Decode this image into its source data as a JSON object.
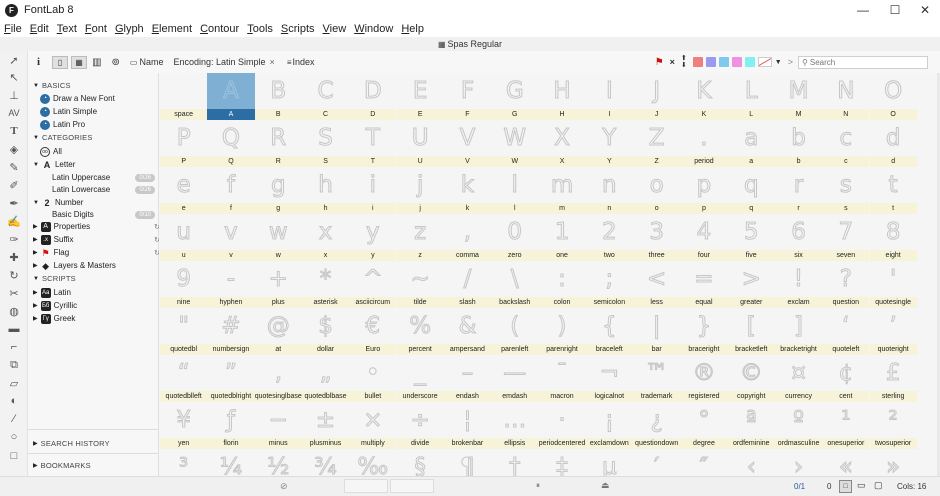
{
  "app": {
    "title": "FontLab 8"
  },
  "window_controls": {
    "minimize": "—",
    "maximize": "☐",
    "close": "✕"
  },
  "menu": [
    "File",
    "Edit",
    "Text",
    "Font",
    "Glyph",
    "Element",
    "Contour",
    "Tools",
    "Scripts",
    "View",
    "Window",
    "Help"
  ],
  "doc": {
    "name": "Spas Regular"
  },
  "toolbar": {
    "info_label": "i",
    "name_label": "Name",
    "encoding_label": "Encoding: Latin Simple",
    "close_x": "×",
    "index_label": "Index",
    "flag_close": "×",
    "more_label": ">",
    "search_placeholder": "Search",
    "swatch_colors": [
      "#f08080",
      "#9a9af0",
      "#7fc8f0",
      "#f090e0",
      "#80f0f0"
    ]
  },
  "sidebar": {
    "basics_header": "BASICS",
    "basics": [
      "Draw a New Font",
      "Latin Simple",
      "Latin Pro"
    ],
    "categories_header": "CATEGORIES",
    "all_label": "All",
    "letter_label": "Letter",
    "latin_uppercase": "Latin Uppercase",
    "latin_uppercase_count": "0/26",
    "latin_lowercase": "Latin Lowercase",
    "latin_lowercase_count": "0/26",
    "number_label": "Number",
    "basic_digits": "Basic Digits",
    "basic_digits_count": "0/10",
    "properties_label": "Properties",
    "suffix_label": "Suffix",
    "flag_label": "Flag",
    "layers_label": "Layers & Masters",
    "scripts_header": "SCRIPTS",
    "scripts": [
      "Latin",
      "Cyrillic",
      "Greek"
    ],
    "search_history": "SEARCH HISTORY",
    "bookmarks": "BOOKMARKS"
  },
  "glyphs": [
    {
      "g": "",
      "n": "space"
    },
    {
      "g": "A",
      "n": "A"
    },
    {
      "g": "B",
      "n": "B"
    },
    {
      "g": "C",
      "n": "C"
    },
    {
      "g": "D",
      "n": "D"
    },
    {
      "g": "E",
      "n": "E"
    },
    {
      "g": "F",
      "n": "F"
    },
    {
      "g": "G",
      "n": "G"
    },
    {
      "g": "H",
      "n": "H"
    },
    {
      "g": "I",
      "n": "I"
    },
    {
      "g": "J",
      "n": "J"
    },
    {
      "g": "K",
      "n": "K"
    },
    {
      "g": "L",
      "n": "L"
    },
    {
      "g": "M",
      "n": "M"
    },
    {
      "g": "N",
      "n": "N"
    },
    {
      "g": "O",
      "n": "O"
    },
    {
      "g": "P",
      "n": "P"
    },
    {
      "g": "Q",
      "n": "Q"
    },
    {
      "g": "R",
      "n": "R"
    },
    {
      "g": "S",
      "n": "S"
    },
    {
      "g": "T",
      "n": "T"
    },
    {
      "g": "U",
      "n": "U"
    },
    {
      "g": "V",
      "n": "V"
    },
    {
      "g": "W",
      "n": "W"
    },
    {
      "g": "X",
      "n": "X"
    },
    {
      "g": "Y",
      "n": "Y"
    },
    {
      "g": "Z",
      "n": "Z"
    },
    {
      "g": ".",
      "n": "period"
    },
    {
      "g": "a",
      "n": "a"
    },
    {
      "g": "b",
      "n": "b"
    },
    {
      "g": "c",
      "n": "c"
    },
    {
      "g": "d",
      "n": "d"
    },
    {
      "g": "e",
      "n": "e"
    },
    {
      "g": "f",
      "n": "f"
    },
    {
      "g": "g",
      "n": "g"
    },
    {
      "g": "h",
      "n": "h"
    },
    {
      "g": "i",
      "n": "i"
    },
    {
      "g": "j",
      "n": "j"
    },
    {
      "g": "k",
      "n": "k"
    },
    {
      "g": "l",
      "n": "l"
    },
    {
      "g": "m",
      "n": "m"
    },
    {
      "g": "n",
      "n": "n"
    },
    {
      "g": "o",
      "n": "o"
    },
    {
      "g": "p",
      "n": "p"
    },
    {
      "g": "q",
      "n": "q"
    },
    {
      "g": "r",
      "n": "r"
    },
    {
      "g": "s",
      "n": "s"
    },
    {
      "g": "t",
      "n": "t"
    },
    {
      "g": "u",
      "n": "u"
    },
    {
      "g": "v",
      "n": "v"
    },
    {
      "g": "w",
      "n": "w"
    },
    {
      "g": "x",
      "n": "x"
    },
    {
      "g": "y",
      "n": "y"
    },
    {
      "g": "z",
      "n": "z"
    },
    {
      "g": ",",
      "n": "comma"
    },
    {
      "g": "0",
      "n": "zero"
    },
    {
      "g": "1",
      "n": "one"
    },
    {
      "g": "2",
      "n": "two"
    },
    {
      "g": "3",
      "n": "three"
    },
    {
      "g": "4",
      "n": "four"
    },
    {
      "g": "5",
      "n": "five"
    },
    {
      "g": "6",
      "n": "six"
    },
    {
      "g": "7",
      "n": "seven"
    },
    {
      "g": "8",
      "n": "eight"
    },
    {
      "g": "9",
      "n": "nine"
    },
    {
      "g": "-",
      "n": "hyphen"
    },
    {
      "g": "+",
      "n": "plus"
    },
    {
      "g": "*",
      "n": "asterisk"
    },
    {
      "g": "^",
      "n": "asciicircum"
    },
    {
      "g": "~",
      "n": "tilde"
    },
    {
      "g": "/",
      "n": "slash"
    },
    {
      "g": "\\",
      "n": "backslash"
    },
    {
      "g": ":",
      "n": "colon"
    },
    {
      "g": ";",
      "n": "semicolon"
    },
    {
      "g": "<",
      "n": "less"
    },
    {
      "g": "=",
      "n": "equal"
    },
    {
      "g": ">",
      "n": "greater"
    },
    {
      "g": "!",
      "n": "exclam"
    },
    {
      "g": "?",
      "n": "question"
    },
    {
      "g": "'",
      "n": "quotesingle"
    },
    {
      "g": "\"",
      "n": "quotedbl"
    },
    {
      "g": "#",
      "n": "numbersign"
    },
    {
      "g": "@",
      "n": "at"
    },
    {
      "g": "$",
      "n": "dollar"
    },
    {
      "g": "€",
      "n": "Euro"
    },
    {
      "g": "%",
      "n": "percent"
    },
    {
      "g": "&",
      "n": "ampersand"
    },
    {
      "g": "(",
      "n": "parenleft"
    },
    {
      "g": ")",
      "n": "parenright"
    },
    {
      "g": "{",
      "n": "braceleft"
    },
    {
      "g": "|",
      "n": "bar"
    },
    {
      "g": "}",
      "n": "braceright"
    },
    {
      "g": "[",
      "n": "bracketleft"
    },
    {
      "g": "]",
      "n": "bracketright"
    },
    {
      "g": "‘",
      "n": "quoteleft"
    },
    {
      "g": "’",
      "n": "quoteright"
    },
    {
      "g": "“",
      "n": "quotedblleft"
    },
    {
      "g": "”",
      "n": "quotedblright"
    },
    {
      "g": "‚",
      "n": "quotesinglbase"
    },
    {
      "g": "„",
      "n": "quotedblbase"
    },
    {
      "g": "•",
      "n": "bullet"
    },
    {
      "g": "_",
      "n": "underscore"
    },
    {
      "g": "–",
      "n": "endash"
    },
    {
      "g": "—",
      "n": "emdash"
    },
    {
      "g": "¯",
      "n": "macron"
    },
    {
      "g": "¬",
      "n": "logicalnot"
    },
    {
      "g": "™",
      "n": "trademark"
    },
    {
      "g": "®",
      "n": "registered"
    },
    {
      "g": "©",
      "n": "copyright"
    },
    {
      "g": "¤",
      "n": "currency"
    },
    {
      "g": "¢",
      "n": "cent"
    },
    {
      "g": "£",
      "n": "sterling"
    },
    {
      "g": "¥",
      "n": "yen"
    },
    {
      "g": "ƒ",
      "n": "florin"
    },
    {
      "g": "−",
      "n": "minus"
    },
    {
      "g": "±",
      "n": "plusminus"
    },
    {
      "g": "×",
      "n": "multiply"
    },
    {
      "g": "÷",
      "n": "divide"
    },
    {
      "g": "¦",
      "n": "brokenbar"
    },
    {
      "g": "…",
      "n": "ellipsis"
    },
    {
      "g": "·",
      "n": "periodcentered"
    },
    {
      "g": "¡",
      "n": "exclamdown"
    },
    {
      "g": "¿",
      "n": "questiondown"
    },
    {
      "g": "°",
      "n": "degree"
    },
    {
      "g": "ª",
      "n": "ordfeminine"
    },
    {
      "g": "º",
      "n": "ordmasculine"
    },
    {
      "g": "¹",
      "n": "onesuperior"
    },
    {
      "g": "²",
      "n": "twosuperior"
    },
    {
      "g": "³",
      "n": ""
    },
    {
      "g": "¼",
      "n": ""
    },
    {
      "g": "½",
      "n": ""
    },
    {
      "g": "¾",
      "n": ""
    },
    {
      "g": "‰",
      "n": ""
    },
    {
      "g": "§",
      "n": ""
    },
    {
      "g": "¶",
      "n": ""
    },
    {
      "g": "†",
      "n": ""
    },
    {
      "g": "‡",
      "n": ""
    },
    {
      "g": "µ",
      "n": ""
    },
    {
      "g": "′",
      "n": ""
    },
    {
      "g": "″",
      "n": ""
    },
    {
      "g": "‹",
      "n": ""
    },
    {
      "g": "›",
      "n": ""
    },
    {
      "g": "«",
      "n": ""
    },
    {
      "g": "»",
      "n": ""
    }
  ],
  "status": {
    "page": "0/1",
    "count": "0",
    "cols": "Cols: 16"
  }
}
